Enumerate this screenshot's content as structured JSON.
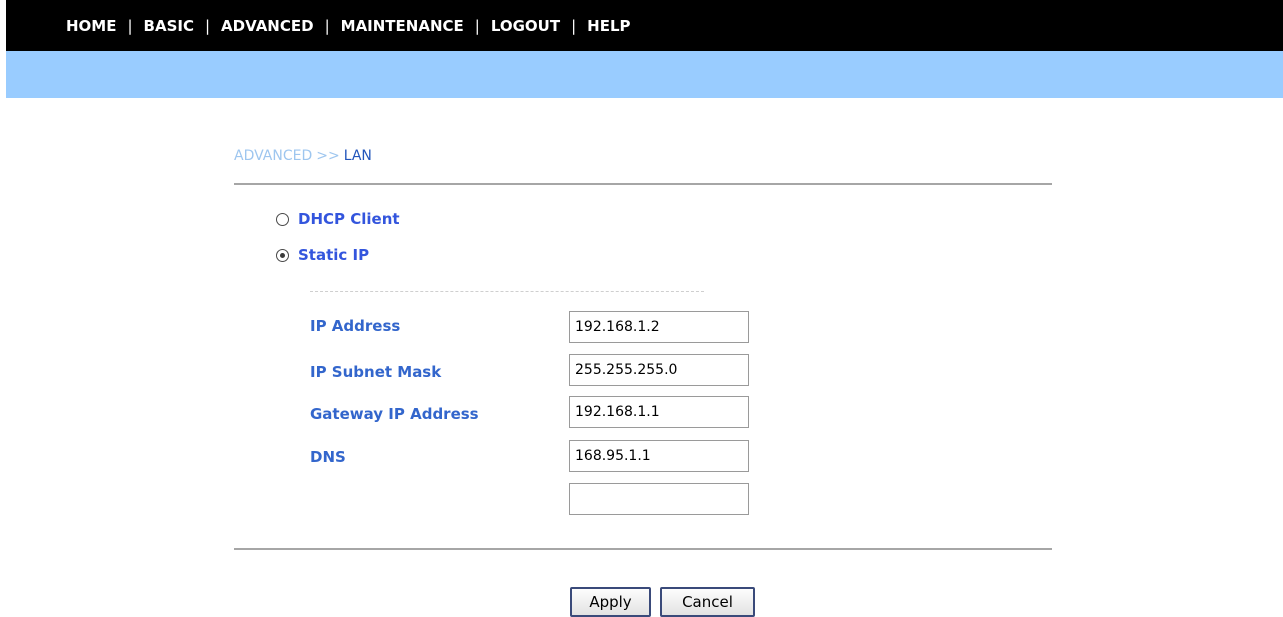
{
  "nav": {
    "items": [
      "HOME",
      "BASIC",
      "ADVANCED",
      "MAINTENANCE",
      "LOGOUT",
      "HELP"
    ],
    "separator": "|"
  },
  "breadcrumb": {
    "parent": "ADVANCED",
    "separator": ">>",
    "current": "LAN"
  },
  "mode": {
    "options": [
      {
        "label": "DHCP Client",
        "checked": false
      },
      {
        "label": "Static IP",
        "checked": true
      }
    ]
  },
  "fields": [
    {
      "label": "IP Address",
      "value": "192.168.1.2"
    },
    {
      "label": "IP Subnet Mask",
      "value": "255.255.255.0"
    },
    {
      "label": "Gateway IP Address",
      "value": "192.168.1.1"
    },
    {
      "label": "DNS",
      "value": "168.95.1.1"
    },
    {
      "label": "",
      "value": ""
    }
  ],
  "buttons": {
    "apply": "Apply",
    "cancel": "Cancel"
  },
  "colors": {
    "nav_bg": "#000000",
    "subbar_bg": "#99ccff",
    "label_blue": "#3366cc"
  }
}
